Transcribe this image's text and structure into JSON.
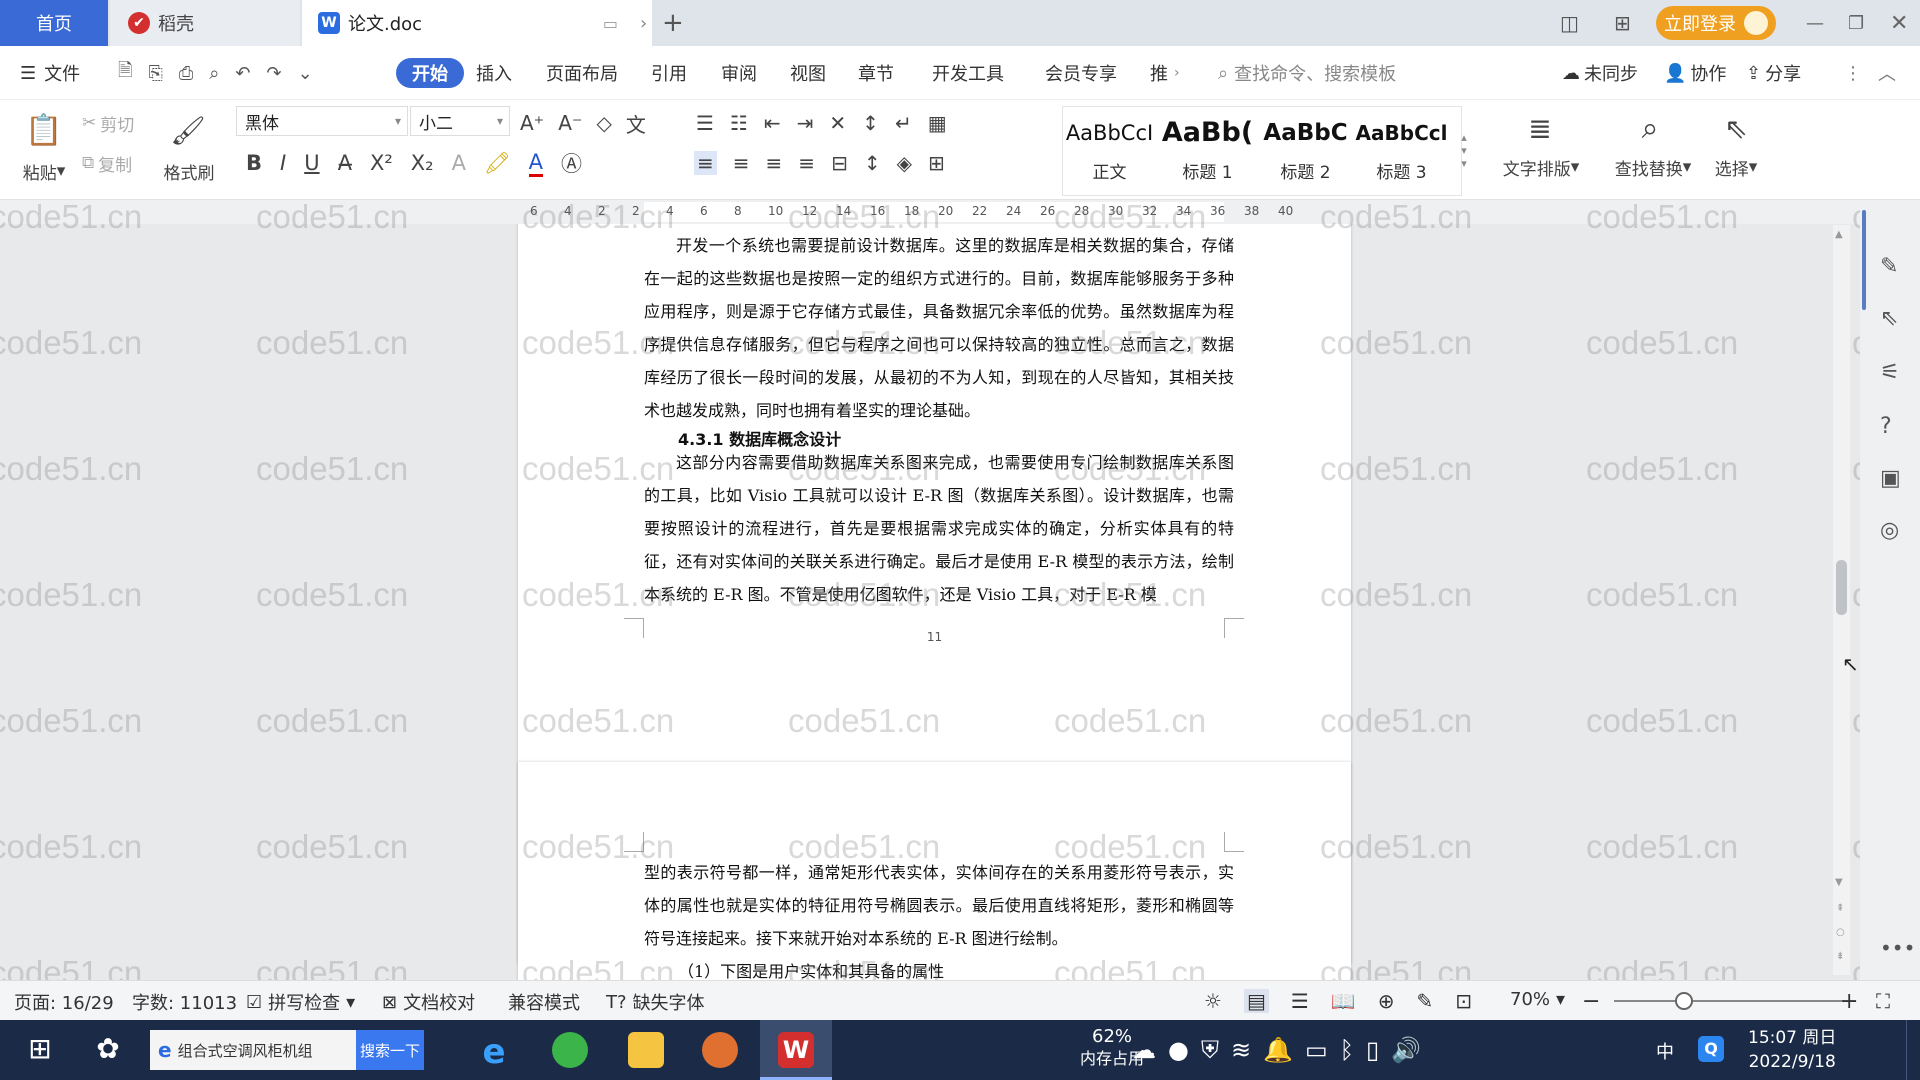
{
  "tabs": {
    "home": "首页",
    "daoke": "稻壳",
    "doc": "论文.doc",
    "login": "立即登录"
  },
  "menu": {
    "file": "文件",
    "items": [
      "开始",
      "插入",
      "页面布局",
      "引用",
      "审阅",
      "视图",
      "章节",
      "开发工具",
      "会员专享",
      "推"
    ],
    "search_cmd": "查找命令、搜索模板",
    "unsynced": "未同步",
    "collab": "协作",
    "share": "分享"
  },
  "toolbar": {
    "paste": "粘贴",
    "cut": "剪切",
    "copy": "复制",
    "format_painter": "格式刷",
    "font": "黑体",
    "size": "小二",
    "text_layout": "文字排版",
    "find_replace": "查找替换",
    "select": "选择"
  },
  "styles": [
    {
      "preview": "AaBbCcI",
      "name": "正文"
    },
    {
      "preview": "AaBb(",
      "name": "标题 1"
    },
    {
      "preview": "AaBbC",
      "name": "标题 2"
    },
    {
      "preview": "AaBbCcl",
      "name": "标题 3"
    }
  ],
  "ruler": [
    "6",
    "4",
    "2",
    "2",
    "4",
    "6",
    "8",
    "10",
    "12",
    "14",
    "16",
    "18",
    "20",
    "22",
    "24",
    "26",
    "28",
    "30",
    "32",
    "34",
    "36",
    "38",
    "40"
  ],
  "doc": {
    "p1": "开发一个系统也需要提前设计数据库。这里的数据库是相关数据的集合，存储在一起的这些数据也是按照一定的组织方式进行的。目前，数据库能够服务于多种应用程序，则是源于它存储方式最佳，具备数据冗余率低的优势。虽然数据库为程序提供信息存储服务，但它与程序之间也可以保持较高的独立性。总而言之，数据库经历了很长一段时间的发展，从最初的不为人知，到现在的人尽皆知，其相关技术也越发成熟，同时也拥有着坚实的理论基础。",
    "heading": "4.3.1  数据库概念设计",
    "p2": "这部分内容需要借助数据库关系图来完成，也需要使用专门绘制数据库关系图的工具，比如 Visio 工具就可以设计 E-R 图（数据库关系图）。设计数据库，也需要按照设计的流程进行，首先是要根据需求完成实体的确定，分析实体具有的特征，还有对实体间的关联关系进行确定。最后才是使用 E-R 模型的表示方法，绘制本系统的 E-R 图。不管是使用亿图软件，还是 Visio 工具，对于 E-R 模",
    "page_no": "11",
    "p3": "型的表示符号都一样，通常矩形代表实体，实体间存在的关系用菱形符号表示，实体的属性也就是实体的特征用符号椭圆表示。最后使用直线将矩形，菱形和椭圆等符号连接起来。接下来就开始对本系统的 E-R 图进行绘制。",
    "p4": "（1）下图是用户实体和其具备的属性"
  },
  "watermark": "code51.cn",
  "status": {
    "page": "页面: 16/29",
    "words": "字数: 11013",
    "spell": "拼写检查",
    "proof": "文档校对",
    "compat": "兼容模式",
    "missing_font": "缺失字体",
    "zoom": "70%"
  },
  "taskbar": {
    "search_text": "组合式空调风柜机组",
    "search_btn": "搜索一下",
    "mem_pct": "62%",
    "mem_label": "内存占用",
    "ime": "中",
    "time": "15:07 周日",
    "date": "2022/9/18"
  },
  "colors": {
    "accent": "#3a6ad6",
    "login": "#f0a020",
    "wps_red": "#d32f2f"
  }
}
